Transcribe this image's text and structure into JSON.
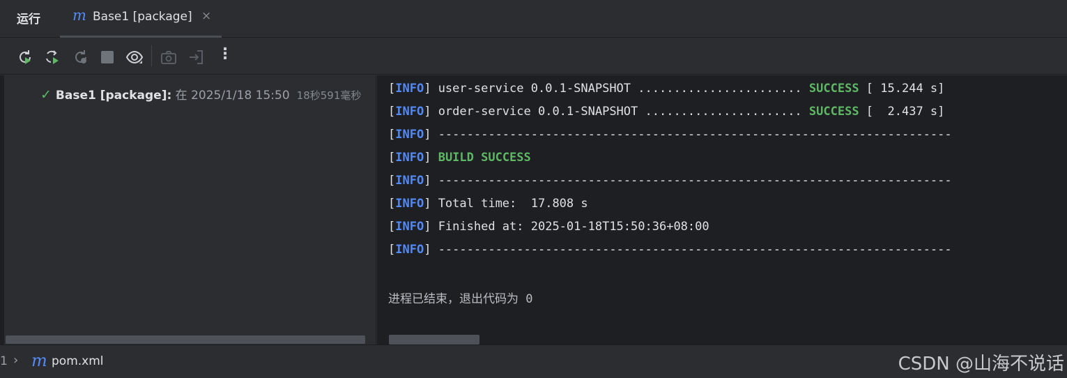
{
  "header": {
    "panel_title": "运行",
    "tab": {
      "icon": "m",
      "label": "Base1 [package]",
      "close": "×"
    }
  },
  "toolbar": {
    "buttons": [
      "rerun-icon",
      "rerun-failed-icon",
      "rerun-modified-icon",
      "stop-icon",
      "eye-icon",
      "camera-icon",
      "exit-icon",
      "more-icon"
    ],
    "more_label": "⋮"
  },
  "tree": {
    "check": "✓",
    "title": "Base1 [package]:",
    "date": " 在 2025/1/18 15:50",
    "duration": "18秒591毫秒"
  },
  "console": {
    "lines": [
      {
        "tag": "INFO",
        "text": " user-service 0.0.1-SNAPSHOT ....................... ",
        "status": "SUCCESS",
        "tail": " [ 15.244 s]"
      },
      {
        "tag": "INFO",
        "text": " order-service 0.0.1-SNAPSHOT ...................... ",
        "status": "SUCCESS",
        "tail": " [  2.437 s]"
      },
      {
        "tag": "INFO",
        "text": " ------------------------------------------------------------------------",
        "status": "",
        "tail": ""
      },
      {
        "tag": "INFO",
        "text": " ",
        "status": "BUILD SUCCESS",
        "tail": ""
      },
      {
        "tag": "INFO",
        "text": " ------------------------------------------------------------------------",
        "status": "",
        "tail": ""
      },
      {
        "tag": "INFO",
        "text": " Total time:  17.808 s",
        "status": "",
        "tail": ""
      },
      {
        "tag": "INFO",
        "text": " Finished at: 2025-01-18T15:50:36+08:00",
        "status": "",
        "tail": ""
      },
      {
        "tag": "INFO",
        "text": " ------------------------------------------------------------------------",
        "status": "",
        "tail": ""
      }
    ],
    "exit_message": "进程已结束，退出代码为 0"
  },
  "statusbar": {
    "number": "1",
    "chevron": "›",
    "file_icon": "m",
    "file": "pom.xml",
    "watermark": "CSDN @山海不说话"
  },
  "colors": {
    "info": "#548af7",
    "success": "#5fb865",
    "console_bg": "#1e1f22",
    "panel_bg": "#2b2d30"
  }
}
